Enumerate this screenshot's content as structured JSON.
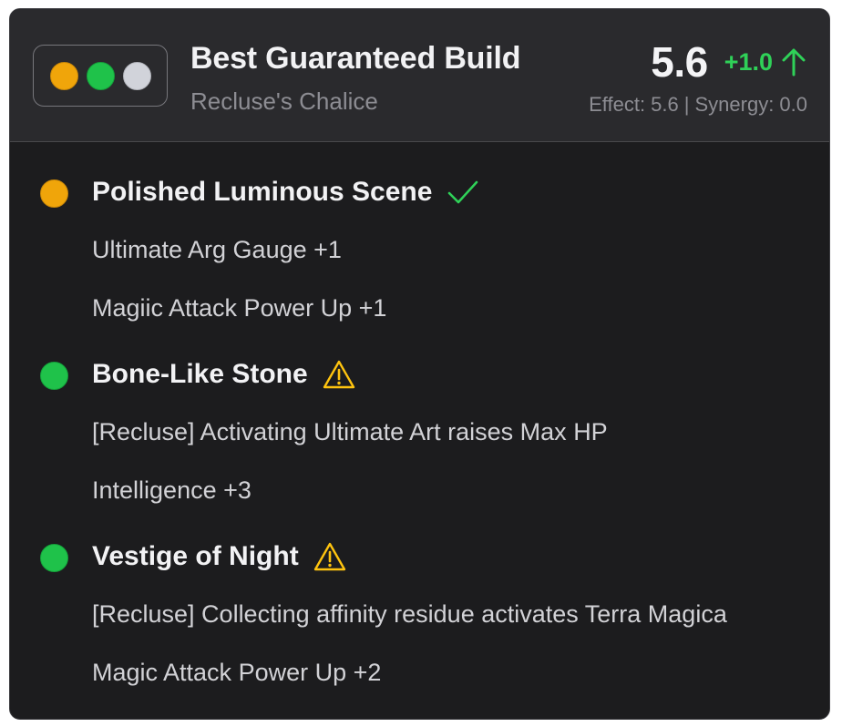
{
  "colors": {
    "gold": "#f0a50a",
    "green": "#1fc24a",
    "gray": "#d1d3da",
    "positive": "#2fd158",
    "warning": "#ffc40f"
  },
  "header": {
    "title": "Best Guaranteed Build",
    "subtitle": "Recluse's Chalice",
    "score": "5.6",
    "delta": "+1.0",
    "delta_icon": "arrow-up-icon",
    "effect_label": "Effect: 5.6",
    "separator": "|",
    "synergy_label": "Synergy: 0.0",
    "slot_dots": [
      "gold",
      "green",
      "gray"
    ]
  },
  "items": [
    {
      "name": "Polished Luminous Scene",
      "color": "gold",
      "status_icon": "check-icon",
      "effects": [
        "Ultimate Arg Gauge +1",
        "Magiic Attack Power Up +1"
      ]
    },
    {
      "name": "Bone-Like Stone",
      "color": "green",
      "status_icon": "warning-icon",
      "effects": [
        "[Recluse] Activating Ultimate Art raises Max HP",
        "Intelligence +3"
      ]
    },
    {
      "name": "Vestige of Night",
      "color": "green",
      "status_icon": "warning-icon",
      "effects": [
        "[Recluse] Collecting affinity residue activates Terra Magica",
        "Magic Attack Power Up +2"
      ]
    }
  ]
}
